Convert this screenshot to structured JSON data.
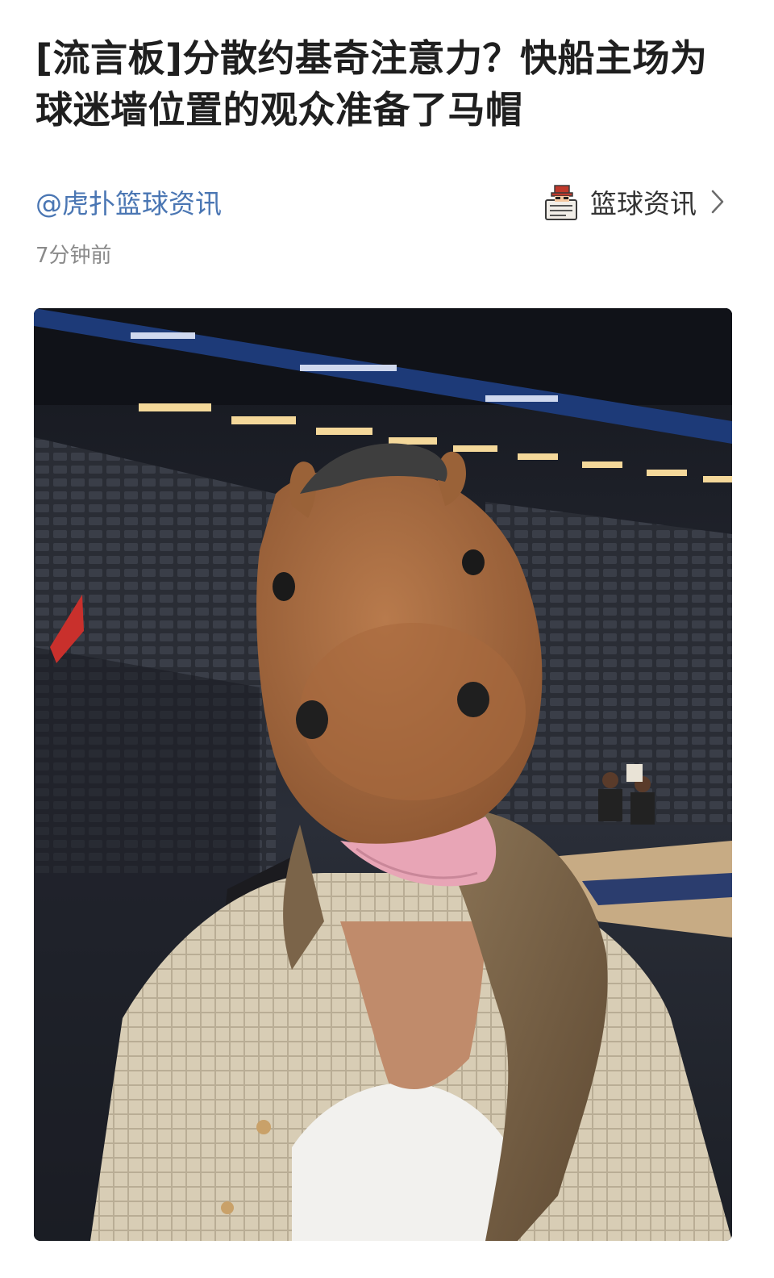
{
  "article": {
    "title": "[流言板]分散约基奇注意力？快船主场为球迷墙位置的观众准备了马帽",
    "author": "@虎扑篮球资讯",
    "channel": {
      "label": "篮球资讯",
      "avatar_icon": "newspaper-reader-icon",
      "chevron_icon": "chevron-right-icon"
    },
    "time": "7分钟前"
  },
  "colors": {
    "link": "#4a76b3",
    "title": "#1f1f1f",
    "muted": "#8a8a8a"
  }
}
